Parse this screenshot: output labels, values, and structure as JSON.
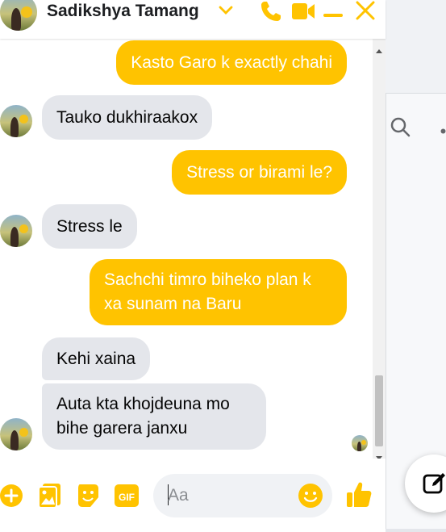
{
  "header": {
    "contact_name": "Sadikshya Tamang"
  },
  "messages": [
    {
      "side": "out",
      "text": "Kasto Garo k exactly chahi"
    },
    {
      "side": "in",
      "text": "Tauko dukhiraakox"
    },
    {
      "side": "out",
      "text": "Stress or birami le?"
    },
    {
      "side": "in",
      "text": "Stress le"
    },
    {
      "side": "out",
      "text": "Sachchi timro biheko plan k xa sunam na Baru"
    },
    {
      "side": "in",
      "text": "Kehi xaina"
    },
    {
      "side": "in",
      "text": "Auta kta khojdeuna mo bihe garera janxu"
    }
  ],
  "composer": {
    "placeholder": "Aa"
  },
  "colors": {
    "accent": "#ffc300",
    "incoming_bubble": "#e4e6eb",
    "icon": "#ffc300"
  },
  "icons": [
    "chevron-down-icon",
    "phone-icon",
    "video-camera-icon",
    "minimize-icon",
    "close-icon",
    "add-icon",
    "photo-icon",
    "sticker-icon",
    "gif-icon",
    "emoji-icon",
    "thumbs-up-icon",
    "search-icon",
    "more-icon",
    "compose-icon"
  ]
}
